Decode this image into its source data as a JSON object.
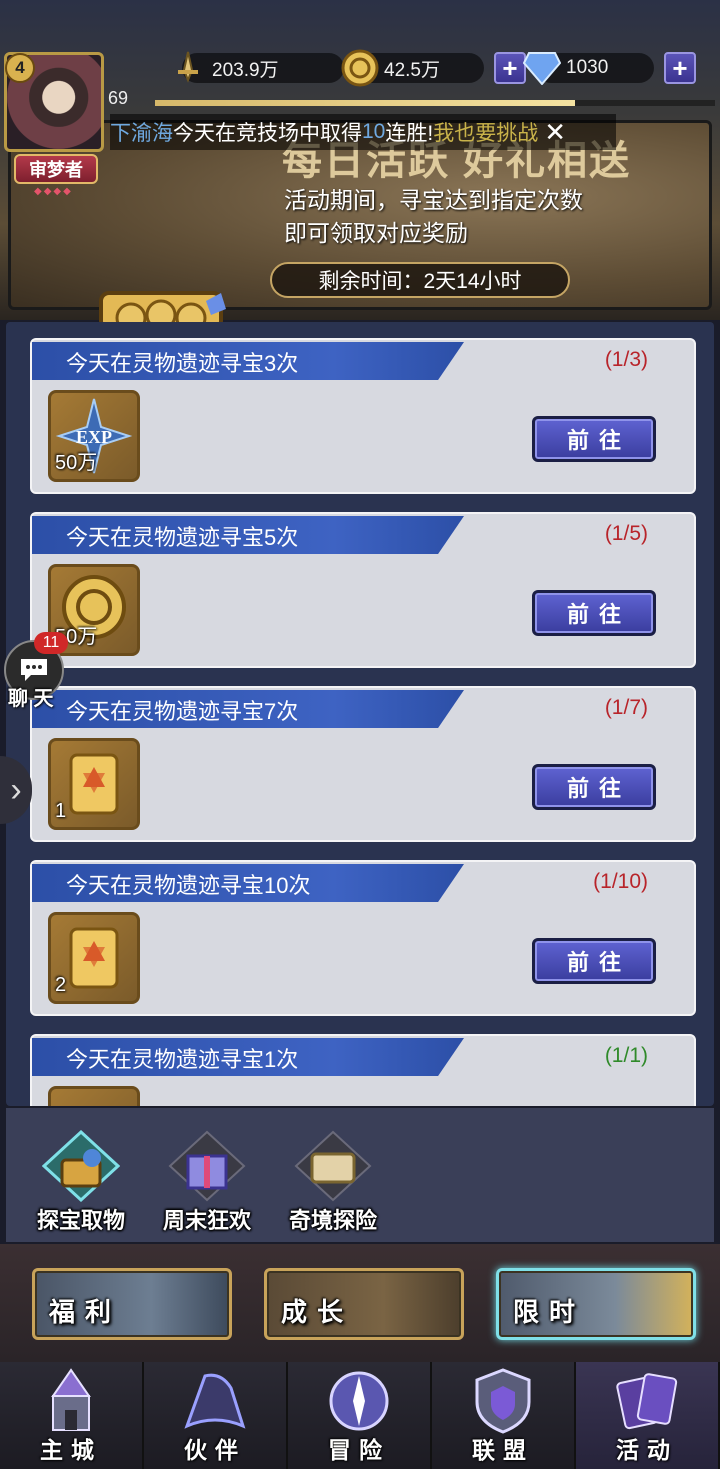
{
  "hud": {
    "player_level": "4",
    "exp_value": "69",
    "exp_progress": 0.75,
    "rank_label": "审梦者",
    "rank_pips": "◆◆◆◆",
    "power": "203.9万",
    "gold": "42.5万",
    "diamonds": "1030",
    "plus": "+"
  },
  "marquee": {
    "player": "下渝海",
    "text_a": "今天在竞技场中取得",
    "num": "10",
    "text_b": "连胜!",
    "link": "我也要挑战",
    "close": "✕"
  },
  "banner": {
    "title": "每日活跃 好礼相送",
    "desc_line1": "活动期间，寻宝达到指定次数",
    "desc_line2": "即可领取对应奖励",
    "timer": "剩余时间：2天14小时"
  },
  "tasks": [
    {
      "title": "今天在灵物遗迹寻宝3次",
      "progress": "(1/3)",
      "reward_qty": "50万",
      "reward_icon": "exp-icon",
      "button": "前往"
    },
    {
      "title": "今天在灵物遗迹寻宝5次",
      "progress": "(1/5)",
      "reward_qty": "50万",
      "reward_icon": "gold-coin-icon",
      "button": "前往"
    },
    {
      "title": "今天在灵物遗迹寻宝7次",
      "progress": "(1/7)",
      "reward_qty": "1",
      "reward_icon": "scroll-icon",
      "button": "前往"
    },
    {
      "title": "今天在灵物遗迹寻宝10次",
      "progress": "(1/10)",
      "reward_qty": "2",
      "reward_icon": "scroll-icon",
      "button": "前往"
    },
    {
      "title": "今天在灵物遗迹寻宝1次",
      "progress": "(1/1)",
      "reward_qty": "",
      "reward_icon": "",
      "button": ""
    }
  ],
  "chat": {
    "badge": "11",
    "label": "聊 天"
  },
  "activities": [
    {
      "label": "探宝取物",
      "icon": "treasure-chest-icon"
    },
    {
      "label": "周末狂欢",
      "icon": "gift-box-icon"
    },
    {
      "label": "奇境探险",
      "icon": "map-scroll-icon"
    }
  ],
  "categories": [
    {
      "label": "福利"
    },
    {
      "label": "成长"
    },
    {
      "label": "限时"
    }
  ],
  "nav": [
    {
      "label": "主城",
      "icon": "castle-icon"
    },
    {
      "label": "伙伴",
      "icon": "wizard-hat-icon"
    },
    {
      "label": "冒险",
      "icon": "compass-icon"
    },
    {
      "label": "联盟",
      "icon": "shield-icon"
    },
    {
      "label": "活动",
      "icon": "cards-icon"
    }
  ],
  "colors": {
    "accent_blue": "#3e63c3",
    "progress_red": "#b8242a",
    "progress_green": "#2f8a2a",
    "gold": "#c8a35a"
  }
}
